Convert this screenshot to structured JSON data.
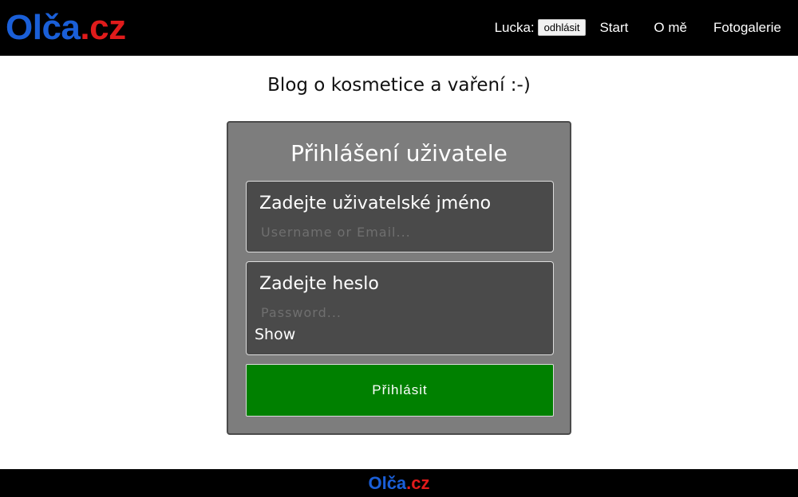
{
  "header": {
    "logo": {
      "part1": "Olča",
      "part2": ".cz"
    },
    "user_label": "Lucka:",
    "logout_label": "odhlásit",
    "nav": {
      "start": "Start",
      "about": "O mě",
      "gallery": "Fotogalerie"
    }
  },
  "tagline": "Blog o kosmetice a vaření :-)",
  "login": {
    "title": "Přihlášení uživatele",
    "username_label": "Zadejte uživatelské jméno",
    "username_placeholder": "Username or Email...",
    "username_value": "",
    "password_label": "Zadejte heslo",
    "password_placeholder": "Password...",
    "password_value": "",
    "show_label": "Show",
    "submit_label": "Přihlásit"
  },
  "footer": {
    "logo": {
      "part1": "Olča",
      "part2": ".cz"
    }
  },
  "colors": {
    "logo_blue": "#1a5fd8",
    "logo_red": "#e01b1b",
    "submit_green": "#008000",
    "box_gray": "#7d7d7d",
    "field_dark": "#4a4a4a"
  }
}
